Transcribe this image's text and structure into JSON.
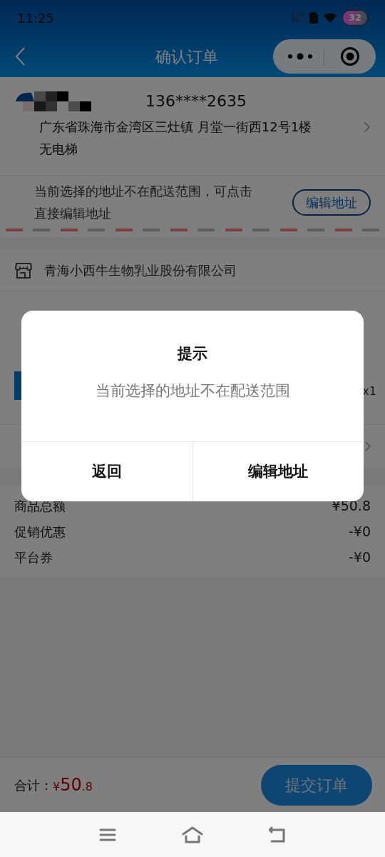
{
  "status_bar": {
    "time": "11:25",
    "speed": "4.20\nKB/s",
    "battery": "32"
  },
  "nav": {
    "title": "确认订单"
  },
  "address": {
    "phone": "136****2635",
    "line": "广东省珠海市金湾区三灶镇 月堂一街西12号1楼无电梯"
  },
  "warning": {
    "text": "当前选择的地址不在配送范围，可点击直接编辑地址",
    "button": "编辑地址"
  },
  "store": {
    "name": "青海小西牛生物乳业股份有限公司"
  },
  "product": {
    "quantity": "x1"
  },
  "summary": [
    {
      "label": "商品总额",
      "value": "¥50.8"
    },
    {
      "label": "促销优惠",
      "value": "-¥0"
    },
    {
      "label": "平台券",
      "value": "-¥0"
    }
  ],
  "footer": {
    "total_label": "合计：",
    "currency": "¥",
    "amount": "50",
    "decimals": ".8",
    "submit": "提交订单"
  },
  "dialog": {
    "title": "提示",
    "message": "当前选择的地址不在配送范围",
    "buttons": [
      {
        "label": "返回"
      },
      {
        "label": "编辑地址"
      }
    ]
  }
}
